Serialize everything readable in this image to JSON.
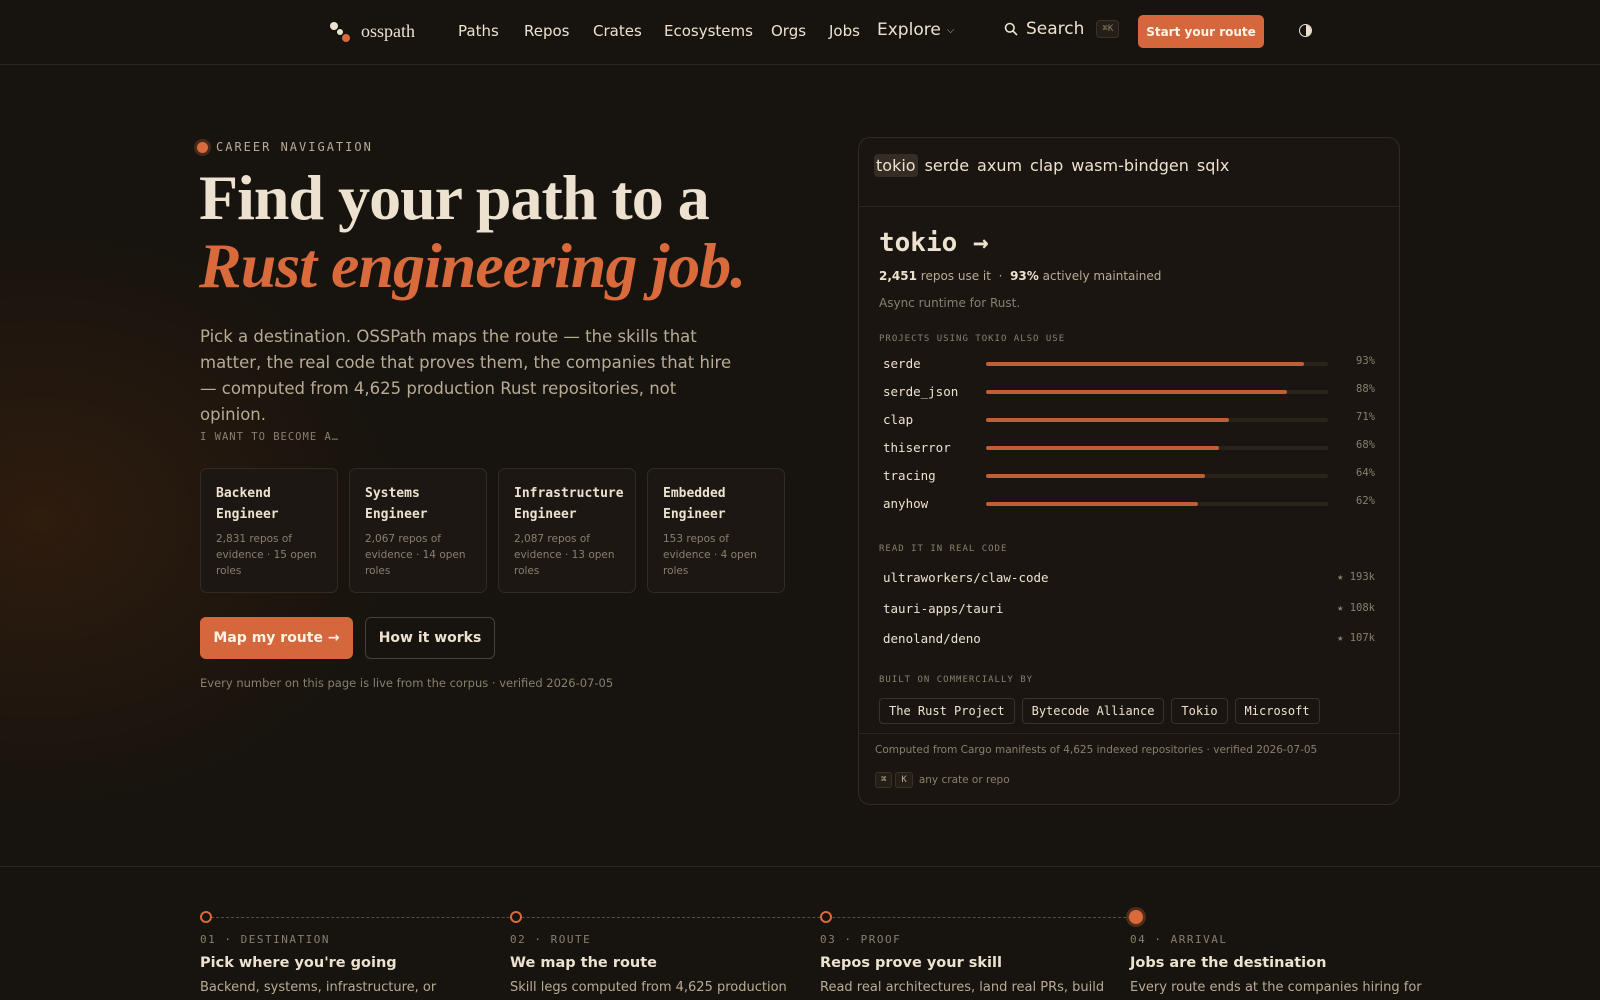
{
  "nav": {
    "logo_text": "osspath",
    "links": [
      "Paths",
      "Repos",
      "Crates",
      "Ecosystems",
      "Orgs",
      "Jobs"
    ],
    "explore_label": "Explore",
    "search_label": "Search",
    "search_shortcut": "⌘K",
    "cta_label": "Start your route"
  },
  "hero": {
    "eyebrow": "CAREER NAVIGATION",
    "title_line1": "Find your path to a",
    "title_line2": "Rust engineering job.",
    "lede": "Pick a destination. OSSPath maps the route — the skills that matter, the real code that proves them, the companies that hire — computed from 4,625 production Rust repositories, not opinion.",
    "roles_label": "I WANT TO BECOME A…",
    "roles": [
      {
        "title": "Backend Engineer",
        "meta": "2,831 repos of evidence · 15 open roles"
      },
      {
        "title": "Systems Engineer",
        "meta": "2,067 repos of evidence · 14 open roles"
      },
      {
        "title": "Infrastructure Engineer",
        "meta": "2,087 repos of evidence · 13 open roles"
      },
      {
        "title": "Embedded Engineer",
        "meta": "153 repos of evidence · 4 open roles"
      }
    ],
    "primary_cta": "Map my route →",
    "secondary_cta": "How it works",
    "live_note": "Every number on this page is live from the corpus · verified 2026-07-05"
  },
  "panel": {
    "crate_tabs": [
      "tokio",
      "serde",
      "axum",
      "clap",
      "wasm-bindgen",
      "sqlx"
    ],
    "selected_crate": "tokio →",
    "repos_count": "2,451",
    "repos_label": "repos use it",
    "separator": "·",
    "maintained_pct": "93%",
    "maintained_label": "actively maintained",
    "description": "Async runtime for Rust.",
    "cooccur_label": "PROJECTS USING TOKIO ALSO USE",
    "cooccur": [
      {
        "name": "serde",
        "pct": 93,
        "pct_label": "93%"
      },
      {
        "name": "serde_json",
        "pct": 88,
        "pct_label": "88%"
      },
      {
        "name": "clap",
        "pct": 71,
        "pct_label": "71%"
      },
      {
        "name": "thiserror",
        "pct": 68,
        "pct_label": "68%"
      },
      {
        "name": "tracing",
        "pct": 64,
        "pct_label": "64%"
      },
      {
        "name": "anyhow",
        "pct": 62,
        "pct_label": "62%"
      }
    ],
    "real_code_label": "READ IT IN REAL CODE",
    "repos": [
      {
        "name": "ultraworkers/claw-code",
        "stars": "★ 193k"
      },
      {
        "name": "tauri-apps/tauri",
        "stars": "★ 108k"
      },
      {
        "name": "denoland/deno",
        "stars": "★ 107k"
      }
    ],
    "commercial_label": "BUILT ON COMMERCIALLY BY",
    "orgs": [
      "The Rust Project",
      "Bytecode Alliance",
      "Tokio",
      "Microsoft"
    ],
    "computed_note": "Computed from Cargo manifests of 4,625 indexed repositories · verified 2026-07-05",
    "kbd_keys": [
      "⌘",
      "K"
    ],
    "kbd_hint": "any crate or repo"
  },
  "steps": [
    {
      "label": "01 · DESTINATION",
      "title": "Pick where you're going",
      "desc": "Backend, systems, infrastructure, or"
    },
    {
      "label": "02 · ROUTE",
      "title": "We map the route",
      "desc": "Skill legs computed from 4,625 production"
    },
    {
      "label": "03 · PROOF",
      "title": "Repos prove your skill",
      "desc": "Read real architectures, land real PRs, build"
    },
    {
      "label": "04 · ARRIVAL",
      "title": "Jobs are the destination",
      "desc": "Every route ends at the companies hiring for"
    }
  ],
  "colors": {
    "background": "#17130e",
    "accent": "#d86a3c",
    "text": "#ede2cf",
    "muted": "#8a7f6e"
  }
}
